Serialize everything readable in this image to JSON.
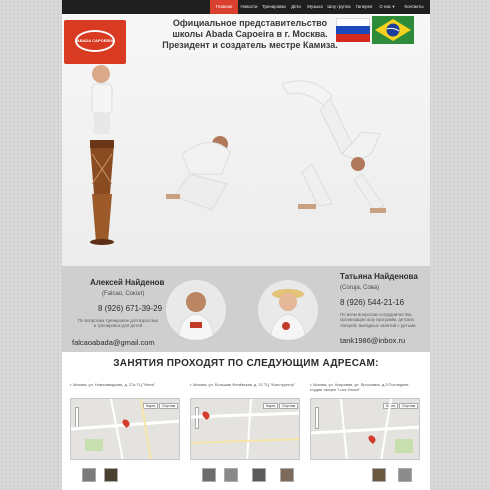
{
  "nav": {
    "items": [
      "Главная",
      "Новости",
      "Тренировки",
      "Дети",
      "Музыка",
      "Шоу группа",
      "Галерея",
      "О нас",
      "Контакты"
    ],
    "active": "Главная"
  },
  "hero": {
    "line1": "Официальное представительство",
    "line2": "школы Abada Capoeira в г. Москва.",
    "line3": "Президент и создатель местре Камиза.",
    "logo_text": "ABADA CAPOEIRA"
  },
  "contacts": {
    "left": {
      "name": "Алексей Найденов",
      "nick": "(Falcao, Сокол)",
      "phone": "8 (926) 671-39-29",
      "note1": "По вопросам тренировок для взрослых",
      "note2": "и тренировок для детей",
      "email": "falcaoabada@gmail.com"
    },
    "right": {
      "name": "Татьяна Найденова",
      "nick": "(Coruja, Сова)",
      "phone": "8 (926) 544-21-16",
      "note1": "По всем вопросам сотрудничества,",
      "note2": "организации шоу программ, детских",
      "note3": "лагерей, выездных занятий с детьми",
      "email": "tank1986@inbox.ru"
    }
  },
  "addresses": {
    "title": "ЗАНЯТИЯ ПРОХОДЯТ ПО СЛЕДУЮЩИМ АДРЕСАМ:",
    "items": [
      {
        "text": "г. Москва, ул. Новозаводская, д. 27а ТЦ \"Филя\""
      },
      {
        "text": "г. Москва, ул. Большая Филёвская, д. 32 ТЦ \"Конструктор\""
      },
      {
        "text": "г. Москва, ул. Кларовая, ул. Ярославск, д.3 Последние студии танцев \"Luce Dance\""
      }
    ],
    "map_button_map": "Карта",
    "map_button_satellite": "Спутник",
    "map_button_hybrid": "Гибрид"
  },
  "colors": {
    "accent": "#d9412e",
    "nav_bg": "#1f1f1f",
    "contacts_bg": "#cfcfcf"
  }
}
